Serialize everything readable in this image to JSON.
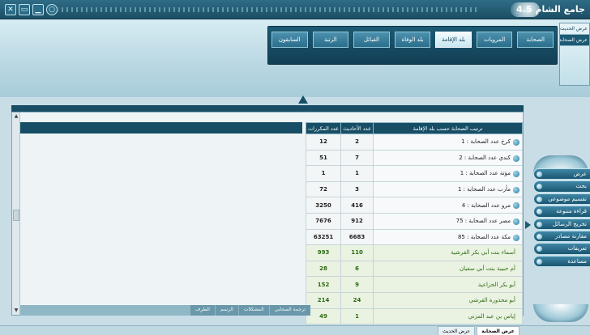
{
  "window": {
    "title": "جامع الشام 4.5"
  },
  "top_menu": {
    "tabs": [
      {
        "label": "الصحابة",
        "active": false
      },
      {
        "label": "المرويات",
        "active": false
      },
      {
        "label": "بلد الإقامة",
        "active": true
      },
      {
        "label": "بلد الوفاة",
        "active": false
      },
      {
        "label": "القبائل",
        "active": false
      },
      {
        "label": "الرتبة",
        "active": false
      },
      {
        "label": "السابقون",
        "active": false
      }
    ]
  },
  "right_panel": {
    "items": [
      {
        "label": "عرض الحديث"
      },
      {
        "label": "عرض الصحابة"
      }
    ]
  },
  "table": {
    "headers": {
      "label": "ترتيب الصحابة حسب بلد الإقامة",
      "hadith": "عدد الأحاديث",
      "count": "عدد المكررات"
    },
    "rows": [
      {
        "label": "كرخ  عدد الصحابة : 1",
        "hadith": "2",
        "count": "12",
        "type": "city"
      },
      {
        "label": "كندي  عدد الصحابة : 2",
        "hadith": "7",
        "count": "51",
        "type": "city"
      },
      {
        "label": "مؤتة  عدد الصحابة : 1",
        "hadith": "1",
        "count": "1",
        "type": "city"
      },
      {
        "label": "مأرب  عدد الصحابة : 1",
        "hadith": "3",
        "count": "72",
        "type": "city"
      },
      {
        "label": "مرو  عدد الصحابة : 4",
        "hadith": "416",
        "count": "3250",
        "type": "city"
      },
      {
        "label": "مصر  عدد الصحابة : 75",
        "hadith": "912",
        "count": "7676",
        "type": "city"
      },
      {
        "label": "مكة  عدد الصحابة : 85",
        "hadith": "6683",
        "count": "63251",
        "type": "city"
      },
      {
        "label": "أسماء بنت أبي بكر القرشية",
        "hadith": "110",
        "count": "993",
        "type": "person"
      },
      {
        "label": "أم حبيبة بنت أبي سفيان",
        "hadith": "6",
        "count": "28",
        "type": "person"
      },
      {
        "label": "أبو بكر الخزاعية",
        "hadith": "9",
        "count": "152",
        "type": "person"
      },
      {
        "label": "أبو محذورة القرشي",
        "hadith": "24",
        "count": "214",
        "type": "person"
      },
      {
        "label": "إياس بن عبد المزني",
        "hadith": "1",
        "count": "49",
        "type": "person"
      }
    ]
  },
  "bottom_tabs": [
    {
      "label": "ترجمة الصحابي",
      "active": false
    },
    {
      "label": "المشكلات",
      "active": false
    },
    {
      "label": "الرسم",
      "active": false
    },
    {
      "label": "الطرف",
      "active": false
    }
  ],
  "side_nav": {
    "items": [
      {
        "label": "عرض"
      },
      {
        "label": "بحث"
      },
      {
        "label": "تقسيم موضوعي"
      },
      {
        "label": "قراءة متنوعة"
      },
      {
        "label": "تخريج الرسائل"
      },
      {
        "label": "مقارنة مصادر"
      },
      {
        "label": "تعريفات"
      },
      {
        "label": "مساعدة"
      }
    ]
  },
  "status_bar": {
    "tabs": [
      {
        "label": "عرض الصحابة",
        "active": true
      },
      {
        "label": "عرض الحديث",
        "active": false
      }
    ]
  }
}
